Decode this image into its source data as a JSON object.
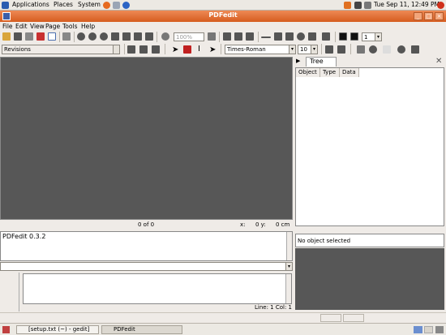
{
  "topbar": {
    "menus": [
      "Applications",
      "Places",
      "System"
    ],
    "clock": "Tue Sep 11, 12:49 PM"
  },
  "window": {
    "title": "PDFedit"
  },
  "menubar": [
    "File",
    "Edit",
    "View",
    "Page",
    "Tools",
    "Help"
  ],
  "toolbar1": {
    "zoom_value": "100%",
    "page_value": "1"
  },
  "toolbar2": {
    "revisions_label": "Revisions",
    "font_value": "Times-Roman",
    "size_value": "10"
  },
  "right_panel": {
    "tab_label": "Tree",
    "columns": [
      "Object",
      "Type",
      "Data"
    ],
    "properties_text": "No object selected"
  },
  "canvas_status": {
    "page_counter": "0 of 0",
    "x_label": "x:",
    "x_value": "0 y:",
    "y_value": "0 cm"
  },
  "console": {
    "version_text": "PDFedit 0.3.2"
  },
  "editor_status": "Line: 1 Col: 1",
  "taskbar": {
    "items": [
      "[setup.txt (~) - gedit]",
      "PDFedit"
    ]
  },
  "colors": {
    "titlebar": "#e0703a",
    "canvas": "#575757",
    "accent": "#d65c1f"
  }
}
